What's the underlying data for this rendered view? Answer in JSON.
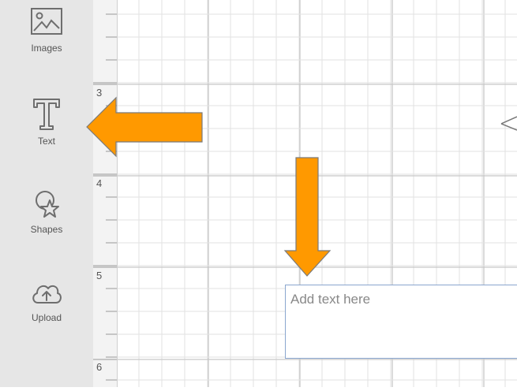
{
  "sidebar": {
    "items": [
      {
        "label": "Images",
        "icon": "images-icon"
      },
      {
        "label": "Text",
        "icon": "text-icon"
      },
      {
        "label": "Shapes",
        "icon": "shapes-icon"
      },
      {
        "label": "Upload",
        "icon": "upload-icon"
      }
    ]
  },
  "ruler": {
    "numbers": [
      "3",
      "4",
      "5",
      "6"
    ]
  },
  "textbox": {
    "placeholder": "Add text here"
  },
  "annotations": {
    "arrow_color": "#ff9900"
  }
}
